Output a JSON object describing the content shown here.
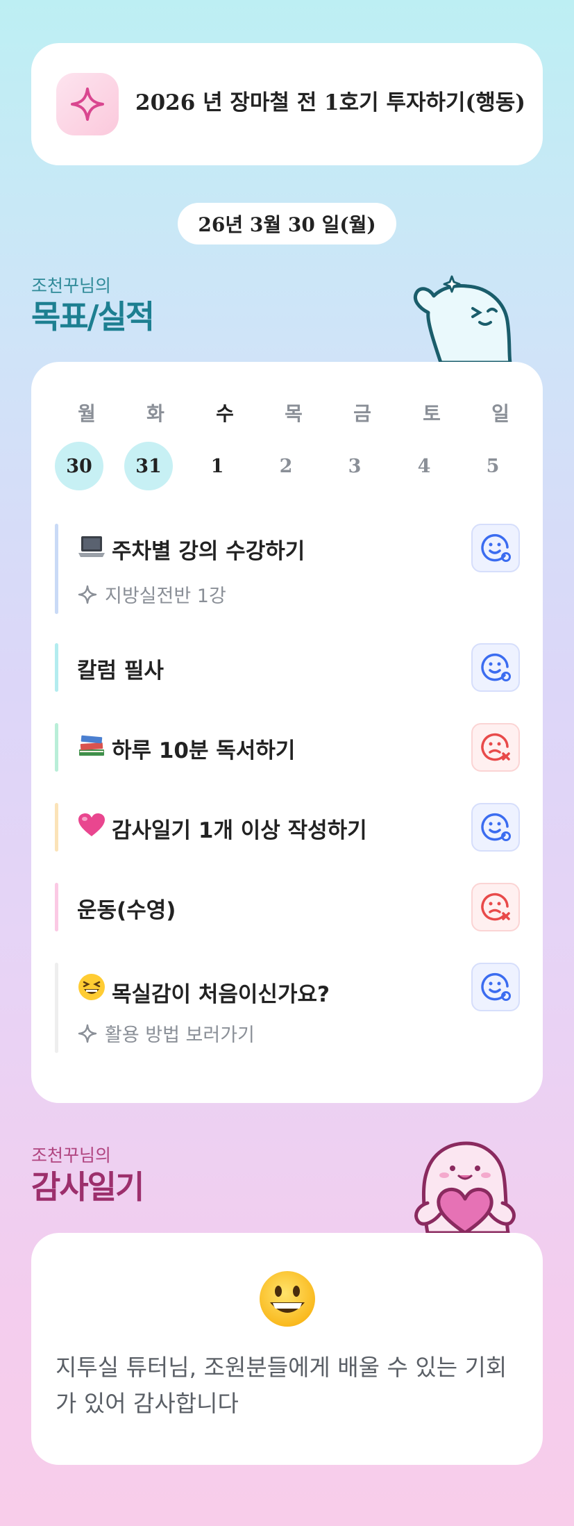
{
  "header": {
    "goal_title": "2026 년 장마철 전 1호기 투자하기(행동)",
    "date": "26년 3월 30 일(월)"
  },
  "goals_section": {
    "subtitle": "조천꾸님의",
    "title": "목표/실적"
  },
  "week": {
    "days": [
      {
        "label": "월",
        "num": "30",
        "state": "past"
      },
      {
        "label": "화",
        "num": "31",
        "state": "past"
      },
      {
        "label": "수",
        "num": "1",
        "state": "today"
      },
      {
        "label": "목",
        "num": "2",
        "state": "future"
      },
      {
        "label": "금",
        "num": "3",
        "state": "future"
      },
      {
        "label": "토",
        "num": "4",
        "state": "future"
      },
      {
        "label": "일",
        "num": "5",
        "state": "future"
      }
    ]
  },
  "goals": [
    {
      "emoji": "laptop-icon",
      "label": "주차별 강의 수강하기",
      "sub": "지방실전반 1강",
      "status": "done",
      "bar_color": "#c9daf6"
    },
    {
      "emoji": "",
      "label": "칼럼 필사",
      "sub": "",
      "status": "done",
      "bar_color": "#b3ecef"
    },
    {
      "emoji": "books-icon",
      "label": "하루 10분 독서하기",
      "sub": "",
      "status": "fail",
      "bar_color": "#b9eed8"
    },
    {
      "emoji": "pink-heart-icon",
      "label": "감사일기 1개 이상 작성하기",
      "sub": "",
      "status": "done",
      "bar_color": "#fbe3b8"
    },
    {
      "emoji": "",
      "label": "운동(수영)",
      "sub": "",
      "status": "fail",
      "bar_color": "#fbc9e4"
    },
    {
      "emoji": "laughing-face-icon",
      "label": "목실감이 처음이신가요?",
      "sub": "활용 방법 보러가기",
      "status": "done",
      "bar_color": "#eeeeee"
    }
  ],
  "thanks_section": {
    "subtitle": "조천꾸님의",
    "title": "감사일기",
    "emoji": "grinning-face-icon",
    "text": "지투실 튜터님, 조원분들에게 배울 수 있는 기회가 있어 감사합니다"
  },
  "colors": {
    "accent_teal": "#1d7f91",
    "accent_pink": "#9c2f6c",
    "done_blue": "#3b6cf0",
    "fail_red": "#e84a4a"
  }
}
